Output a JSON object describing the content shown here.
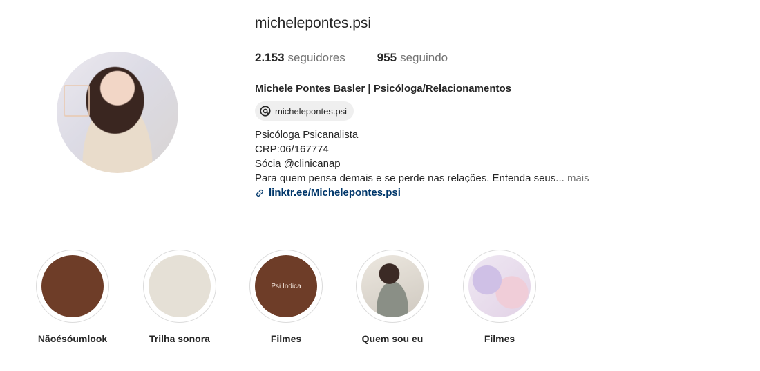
{
  "profile": {
    "username": "michelepontes.psi",
    "followers_count": "2.153",
    "followers_label": "seguidores",
    "following_count": "955",
    "following_label": "seguindo",
    "full_name": "Michele Pontes Basler | Psicóloga/Relacionamentos",
    "threads_handle": "michelepontes.psi",
    "bio_lines": [
      "Psicóloga Psicanalista",
      "CRP:06/167774",
      "Sócia @clinicanap"
    ],
    "bio_last": "Para quem pensa demais e se perde nas relações. Entenda seus...",
    "more_label": "mais",
    "link_text": "linktr.ee/Michelepontes.psi"
  },
  "highlights": [
    {
      "label": "Nãoésóumlook",
      "cover_color": "#6e3d28",
      "cover_text": ""
    },
    {
      "label": "Trilha sonora",
      "cover_color": "#e5e0d6",
      "cover_text": ""
    },
    {
      "label": "Filmes",
      "cover_color": "#6e3d28",
      "cover_text": "Psi Indica"
    },
    {
      "label": "Quem sou eu",
      "cover_color": "#d9d4cc",
      "cover_text": ""
    },
    {
      "label": "Filmes",
      "cover_color": "#e4d9ea",
      "cover_text": ""
    }
  ],
  "icons": {
    "threads": "threads-icon",
    "link": "link-icon"
  }
}
